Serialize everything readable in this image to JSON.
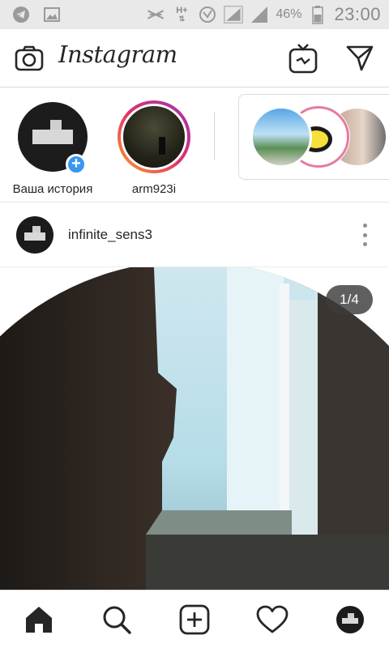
{
  "status_bar": {
    "battery_percent": "46%",
    "time": "23:00",
    "network_label": "H+",
    "icons": [
      "telegram-icon",
      "gallery-icon",
      "mute-icon",
      "network-h-plus-icon",
      "vpn-icon",
      "signal-icon",
      "signal-icon",
      "battery-icon"
    ]
  },
  "header": {
    "brand": "Instagram",
    "icons": [
      "camera-icon",
      "igtv-icon",
      "direct-message-icon"
    ]
  },
  "stories": {
    "items": [
      {
        "label": "Ваша история"
      },
      {
        "label": "arm923i"
      }
    ]
  },
  "post": {
    "username": "infinite_sens3",
    "counter": "1/4"
  },
  "bottom_nav": {
    "icons": [
      "home-icon",
      "search-icon",
      "add-post-icon",
      "activity-heart-icon",
      "profile-avatar-icon"
    ]
  },
  "colors": {
    "accent": "#3897f0",
    "text": "#262626",
    "status_bar_bg": "#e9e9e9",
    "story_ring": [
      "#f9a12e",
      "#e1306c",
      "#9b36b7"
    ]
  }
}
